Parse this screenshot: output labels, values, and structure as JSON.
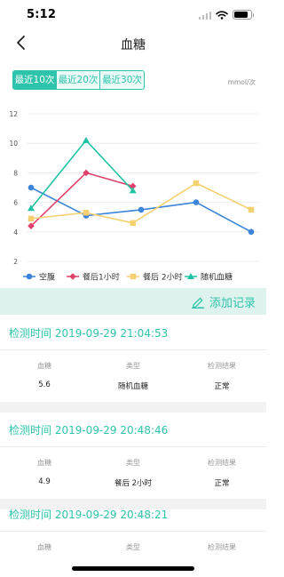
{
  "status": {
    "time": "5:12"
  },
  "nav": {
    "title": "血糖",
    "back_icon": "chevron-left-icon"
  },
  "range_tabs": [
    "最近10次",
    "最近20次",
    "最近30次"
  ],
  "range_active": 0,
  "unit": "mmol/次",
  "colors": {
    "accent": "#2ec4ab",
    "accent_light": "#dff3ee",
    "accent_tab_bg": "#eafaf6"
  },
  "chart_data": {
    "type": "line",
    "title": "",
    "xlabel": "",
    "ylabel": "",
    "y_ticks": [
      2,
      4,
      6,
      8,
      10,
      12
    ],
    "ylim": [
      2,
      12
    ],
    "grid": true,
    "legend_position": "bottom",
    "series": [
      {
        "name": "空腹",
        "color": "#3c84d8",
        "marker": "circle",
        "points": [
          [
            0,
            7.0
          ],
          [
            1,
            5.1
          ],
          [
            2,
            5.5
          ],
          [
            3,
            6.0
          ],
          [
            4,
            4.0
          ]
        ]
      },
      {
        "name": "餐后1小时",
        "color": "#e0416b",
        "marker": "diamond",
        "points": [
          [
            0,
            4.4
          ],
          [
            1,
            8.0
          ],
          [
            1.85,
            7.1
          ]
        ]
      },
      {
        "name": "餐后 2小时",
        "color": "#f5d070",
        "marker": "square",
        "points": [
          [
            0,
            4.9
          ],
          [
            1,
            5.3
          ],
          [
            1.85,
            4.6
          ],
          [
            3,
            7.3
          ],
          [
            4,
            5.5
          ]
        ]
      },
      {
        "name": "随机血糖",
        "color": "#1fc3a4",
        "marker": "triangle",
        "points": [
          [
            0,
            5.6
          ],
          [
            1,
            10.2
          ],
          [
            1.85,
            6.8
          ]
        ]
      }
    ]
  },
  "add_record": {
    "label": "添加记录",
    "icon": "pencil-icon"
  },
  "record_columns": [
    "血糖",
    "类型",
    "检测结果"
  ],
  "records": [
    {
      "time": "检测时间 2019-09-29 21:04:53",
      "value": "5.6",
      "type": "随机血糖",
      "result": "正常"
    },
    {
      "time": "检测时间 2019-09-29 20:48:46",
      "value": "4.9",
      "type": "餐后 2小时",
      "result": "正常"
    },
    {
      "time": "检测时间 2019-09-29 20:48:21",
      "value": "",
      "type": "",
      "result": ""
    }
  ]
}
